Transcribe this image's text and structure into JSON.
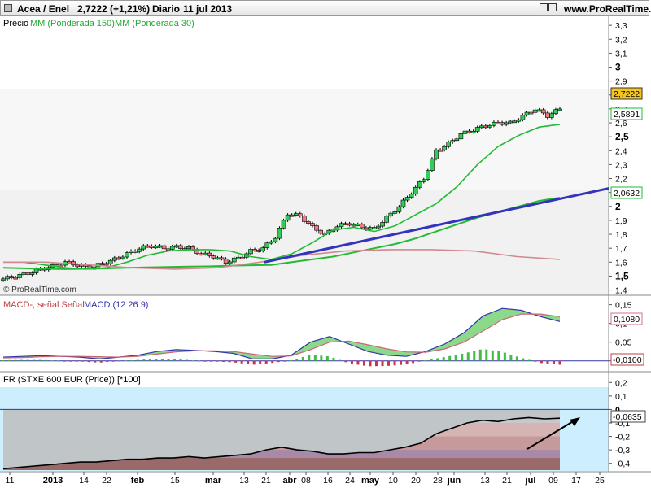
{
  "header": {
    "symbol": "Acea / Enel",
    "last": "2,7222 (+1,21%)",
    "period": "Diario",
    "date": "11 jul 2013",
    "site": "www.ProRealTime.com"
  },
  "watermark": "© ProRealTime.com",
  "chart_data": [
    {
      "type": "candlestick",
      "panel": "price",
      "legend_prefix": "Precio",
      "legend_ma150": "MM (Ponderada 150)",
      "legend_ma30": "MM (Ponderada 30)",
      "ylim": [
        1.38,
        3.33
      ],
      "yticks": [
        "3,3",
        "3,2",
        "3,1",
        "3",
        "2,9",
        "2,8",
        "2,7",
        "2,6",
        "2,5",
        "2,4",
        "2,3",
        "2,2",
        "2,1",
        "2",
        "1,9",
        "1,8",
        "1,7",
        "1,6",
        "1,5",
        "1,4"
      ],
      "ytick_values": [
        3.3,
        3.2,
        3.1,
        3.0,
        2.9,
        2.8,
        2.7,
        2.6,
        2.5,
        2.4,
        2.3,
        2.2,
        2.1,
        2.0,
        1.9,
        1.8,
        1.7,
        1.6,
        1.5,
        1.4
      ],
      "last_price": {
        "label": "2,7222",
        "value": 2.7222,
        "color": "#f5c518"
      },
      "ma30_last": {
        "label": "2,5891",
        "value": 2.5891,
        "color": "#22bb33"
      },
      "ma150_last": {
        "label": "2,0632",
        "value": 2.0632,
        "color": "#22bb33"
      },
      "candle_key_closes": [
        1.48,
        1.5,
        1.52,
        1.55,
        1.57,
        1.6,
        1.58,
        1.56,
        1.59,
        1.62,
        1.66,
        1.7,
        1.72,
        1.7,
        1.71,
        1.7,
        1.66,
        1.64,
        1.6,
        1.63,
        1.68,
        1.7,
        1.78,
        1.95,
        1.93,
        1.85,
        1.8,
        1.86,
        1.88,
        1.85,
        1.84,
        1.92,
        2.0,
        2.1,
        2.2,
        2.4,
        2.45,
        2.52,
        2.55,
        2.58,
        2.6,
        2.6,
        2.65,
        2.7,
        2.65,
        2.7
      ],
      "ma150": [
        1.56,
        1.556,
        1.552,
        1.55,
        1.552,
        1.555,
        1.56,
        1.562,
        1.565,
        1.568,
        1.57,
        1.575,
        1.578,
        1.58,
        1.6,
        1.62,
        1.64,
        1.67,
        1.7,
        1.73,
        1.77,
        1.82,
        1.87,
        1.92,
        1.96,
        2.0,
        2.04,
        2.063
      ],
      "ma30": [
        1.6,
        1.6,
        1.58,
        1.56,
        1.55,
        1.56,
        1.6,
        1.65,
        1.68,
        1.69,
        1.69,
        1.68,
        1.64,
        1.62,
        1.66,
        1.74,
        1.83,
        1.85,
        1.82,
        1.86,
        1.94,
        2.02,
        2.14,
        2.3,
        2.43,
        2.51,
        2.57,
        2.589
      ],
      "trendline": {
        "start_value": 1.6,
        "end_value": 2.13,
        "color": "#3333bb"
      }
    },
    {
      "type": "macd",
      "panel": "macd",
      "legend_main": "MACD-, señal Señal",
      "legend_params": "MACD (12 26 9)",
      "yticks": [
        "0,15",
        "0,1",
        "0,05",
        "0"
      ],
      "ytick_values": [
        0.15,
        0.1,
        0.05,
        0
      ],
      "ylim": [
        -0.018,
        0.16
      ],
      "macd_last": {
        "label": "0,1080",
        "value": 0.108
      },
      "hist_last": {
        "label": "-0,0100",
        "value": -0.01
      },
      "macd": [
        0.01,
        0.012,
        0.014,
        0.012,
        0.01,
        0.005,
        0.01,
        0.015,
        0.025,
        0.03,
        0.028,
        0.025,
        0.02,
        0.005,
        0.005,
        0.015,
        0.05,
        0.065,
        0.045,
        0.025,
        0.015,
        0.012,
        0.025,
        0.045,
        0.075,
        0.12,
        0.14,
        0.135,
        0.118,
        0.105
      ],
      "signal": [
        0.008,
        0.009,
        0.011,
        0.012,
        0.012,
        0.011,
        0.01,
        0.012,
        0.018,
        0.024,
        0.027,
        0.027,
        0.025,
        0.018,
        0.012,
        0.013,
        0.03,
        0.05,
        0.053,
        0.043,
        0.032,
        0.024,
        0.023,
        0.032,
        0.05,
        0.08,
        0.11,
        0.125,
        0.125,
        0.118
      ]
    },
    {
      "type": "area",
      "panel": "relative_strength",
      "legend": "FR (STXE 600 EUR (Price)) [*100]",
      "yticks": [
        "0,2",
        "0,1",
        "0",
        "-0,1",
        "-0,2",
        "-0,3",
        "-0,4"
      ],
      "ytick_values": [
        0.2,
        0.1,
        0,
        -0.1,
        -0.2,
        -0.3,
        -0.4
      ],
      "ylim": [
        -0.45,
        0.25
      ],
      "last": {
        "label": "-0,0635",
        "value": -0.0635
      },
      "series": [
        -0.44,
        -0.43,
        -0.42,
        -0.41,
        -0.4,
        -0.39,
        -0.39,
        -0.38,
        -0.37,
        -0.37,
        -0.36,
        -0.36,
        -0.35,
        -0.36,
        -0.35,
        -0.34,
        -0.33,
        -0.3,
        -0.28,
        -0.3,
        -0.31,
        -0.33,
        -0.33,
        -0.32,
        -0.32,
        -0.3,
        -0.28,
        -0.25,
        -0.18,
        -0.14,
        -0.1,
        -0.08,
        -0.09,
        -0.07,
        -0.06,
        -0.07,
        -0.065
      ]
    }
  ],
  "x_axis": {
    "labels": [
      "11",
      "2013",
      "14",
      "22",
      "feb",
      "15",
      "mar",
      "13",
      "21",
      "abr",
      "08",
      "16",
      "24",
      "may",
      "10",
      "20",
      "28",
      "jun",
      "13",
      "21",
      "jul",
      "09",
      "17",
      "25"
    ],
    "bold": [
      false,
      true,
      false,
      false,
      true,
      false,
      true,
      false,
      false,
      true,
      false,
      false,
      false,
      true,
      false,
      false,
      false,
      true,
      false,
      false,
      true,
      false,
      false,
      false
    ]
  }
}
